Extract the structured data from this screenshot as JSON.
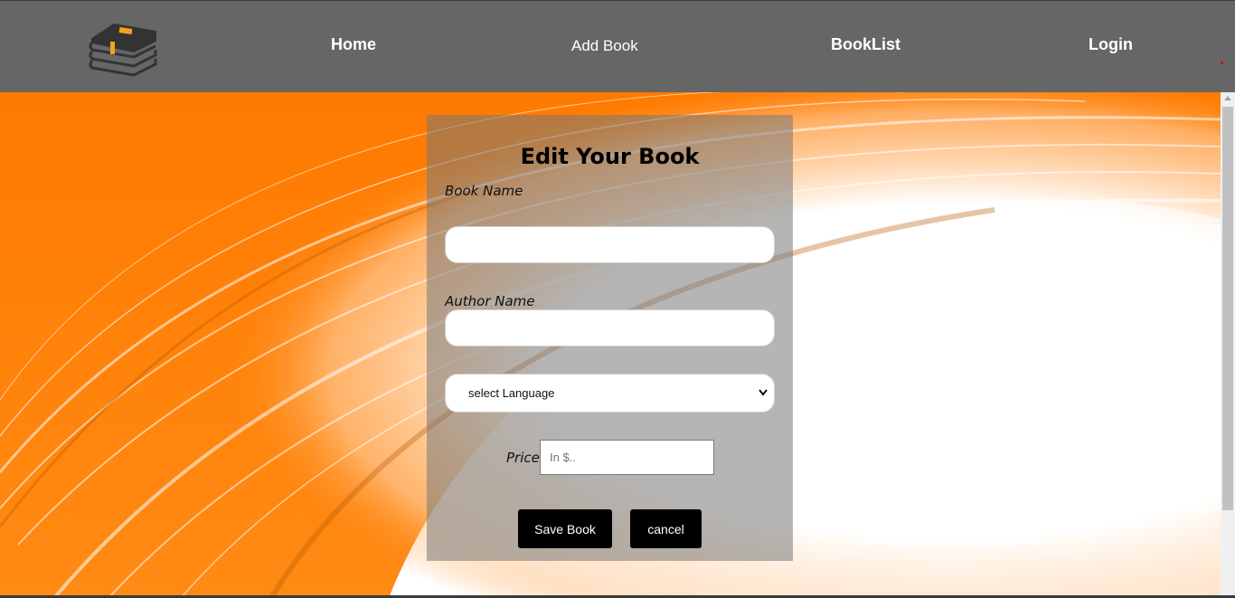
{
  "nav": {
    "logo_icon": "books-stack-icon",
    "links": [
      {
        "label": "Home"
      },
      {
        "label": "Add Book"
      },
      {
        "label": "BookList"
      },
      {
        "label": "Login"
      }
    ]
  },
  "form": {
    "title": "Edit Your Book",
    "book_name_label": "Book Name",
    "book_name_value": "",
    "author_name_label": "Author Name",
    "author_name_value": "",
    "language_select_value": "select Language",
    "price_label": "Price:",
    "price_placeholder": "In $..",
    "save_label": "Save Book",
    "cancel_label": "cancel"
  },
  "colors": {
    "navbar": "#666666",
    "accent_orange": "#ff8000",
    "button": "#000000"
  }
}
